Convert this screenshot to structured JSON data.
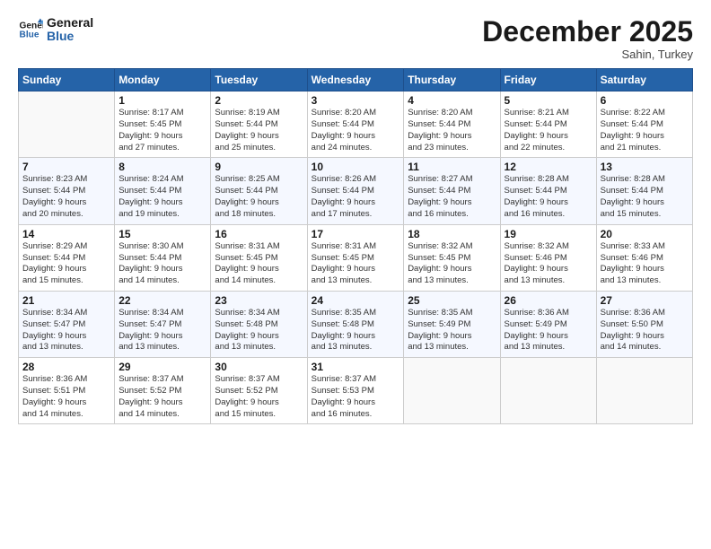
{
  "header": {
    "logo_line1": "General",
    "logo_line2": "Blue",
    "month_title": "December 2025",
    "location": "Sahin, Turkey"
  },
  "weekdays": [
    "Sunday",
    "Monday",
    "Tuesday",
    "Wednesday",
    "Thursday",
    "Friday",
    "Saturday"
  ],
  "weeks": [
    [
      {
        "day": "",
        "info": ""
      },
      {
        "day": "1",
        "info": "Sunrise: 8:17 AM\nSunset: 5:45 PM\nDaylight: 9 hours\nand 27 minutes."
      },
      {
        "day": "2",
        "info": "Sunrise: 8:19 AM\nSunset: 5:44 PM\nDaylight: 9 hours\nand 25 minutes."
      },
      {
        "day": "3",
        "info": "Sunrise: 8:20 AM\nSunset: 5:44 PM\nDaylight: 9 hours\nand 24 minutes."
      },
      {
        "day": "4",
        "info": "Sunrise: 8:20 AM\nSunset: 5:44 PM\nDaylight: 9 hours\nand 23 minutes."
      },
      {
        "day": "5",
        "info": "Sunrise: 8:21 AM\nSunset: 5:44 PM\nDaylight: 9 hours\nand 22 minutes."
      },
      {
        "day": "6",
        "info": "Sunrise: 8:22 AM\nSunset: 5:44 PM\nDaylight: 9 hours\nand 21 minutes."
      }
    ],
    [
      {
        "day": "7",
        "info": "Sunrise: 8:23 AM\nSunset: 5:44 PM\nDaylight: 9 hours\nand 20 minutes."
      },
      {
        "day": "8",
        "info": "Sunrise: 8:24 AM\nSunset: 5:44 PM\nDaylight: 9 hours\nand 19 minutes."
      },
      {
        "day": "9",
        "info": "Sunrise: 8:25 AM\nSunset: 5:44 PM\nDaylight: 9 hours\nand 18 minutes."
      },
      {
        "day": "10",
        "info": "Sunrise: 8:26 AM\nSunset: 5:44 PM\nDaylight: 9 hours\nand 17 minutes."
      },
      {
        "day": "11",
        "info": "Sunrise: 8:27 AM\nSunset: 5:44 PM\nDaylight: 9 hours\nand 16 minutes."
      },
      {
        "day": "12",
        "info": "Sunrise: 8:28 AM\nSunset: 5:44 PM\nDaylight: 9 hours\nand 16 minutes."
      },
      {
        "day": "13",
        "info": "Sunrise: 8:28 AM\nSunset: 5:44 PM\nDaylight: 9 hours\nand 15 minutes."
      }
    ],
    [
      {
        "day": "14",
        "info": "Sunrise: 8:29 AM\nSunset: 5:44 PM\nDaylight: 9 hours\nand 15 minutes."
      },
      {
        "day": "15",
        "info": "Sunrise: 8:30 AM\nSunset: 5:44 PM\nDaylight: 9 hours\nand 14 minutes."
      },
      {
        "day": "16",
        "info": "Sunrise: 8:31 AM\nSunset: 5:45 PM\nDaylight: 9 hours\nand 14 minutes."
      },
      {
        "day": "17",
        "info": "Sunrise: 8:31 AM\nSunset: 5:45 PM\nDaylight: 9 hours\nand 13 minutes."
      },
      {
        "day": "18",
        "info": "Sunrise: 8:32 AM\nSunset: 5:45 PM\nDaylight: 9 hours\nand 13 minutes."
      },
      {
        "day": "19",
        "info": "Sunrise: 8:32 AM\nSunset: 5:46 PM\nDaylight: 9 hours\nand 13 minutes."
      },
      {
        "day": "20",
        "info": "Sunrise: 8:33 AM\nSunset: 5:46 PM\nDaylight: 9 hours\nand 13 minutes."
      }
    ],
    [
      {
        "day": "21",
        "info": "Sunrise: 8:34 AM\nSunset: 5:47 PM\nDaylight: 9 hours\nand 13 minutes."
      },
      {
        "day": "22",
        "info": "Sunrise: 8:34 AM\nSunset: 5:47 PM\nDaylight: 9 hours\nand 13 minutes."
      },
      {
        "day": "23",
        "info": "Sunrise: 8:34 AM\nSunset: 5:48 PM\nDaylight: 9 hours\nand 13 minutes."
      },
      {
        "day": "24",
        "info": "Sunrise: 8:35 AM\nSunset: 5:48 PM\nDaylight: 9 hours\nand 13 minutes."
      },
      {
        "day": "25",
        "info": "Sunrise: 8:35 AM\nSunset: 5:49 PM\nDaylight: 9 hours\nand 13 minutes."
      },
      {
        "day": "26",
        "info": "Sunrise: 8:36 AM\nSunset: 5:49 PM\nDaylight: 9 hours\nand 13 minutes."
      },
      {
        "day": "27",
        "info": "Sunrise: 8:36 AM\nSunset: 5:50 PM\nDaylight: 9 hours\nand 14 minutes."
      }
    ],
    [
      {
        "day": "28",
        "info": "Sunrise: 8:36 AM\nSunset: 5:51 PM\nDaylight: 9 hours\nand 14 minutes."
      },
      {
        "day": "29",
        "info": "Sunrise: 8:37 AM\nSunset: 5:52 PM\nDaylight: 9 hours\nand 14 minutes."
      },
      {
        "day": "30",
        "info": "Sunrise: 8:37 AM\nSunset: 5:52 PM\nDaylight: 9 hours\nand 15 minutes."
      },
      {
        "day": "31",
        "info": "Sunrise: 8:37 AM\nSunset: 5:53 PM\nDaylight: 9 hours\nand 16 minutes."
      },
      {
        "day": "",
        "info": ""
      },
      {
        "day": "",
        "info": ""
      },
      {
        "day": "",
        "info": ""
      }
    ]
  ]
}
